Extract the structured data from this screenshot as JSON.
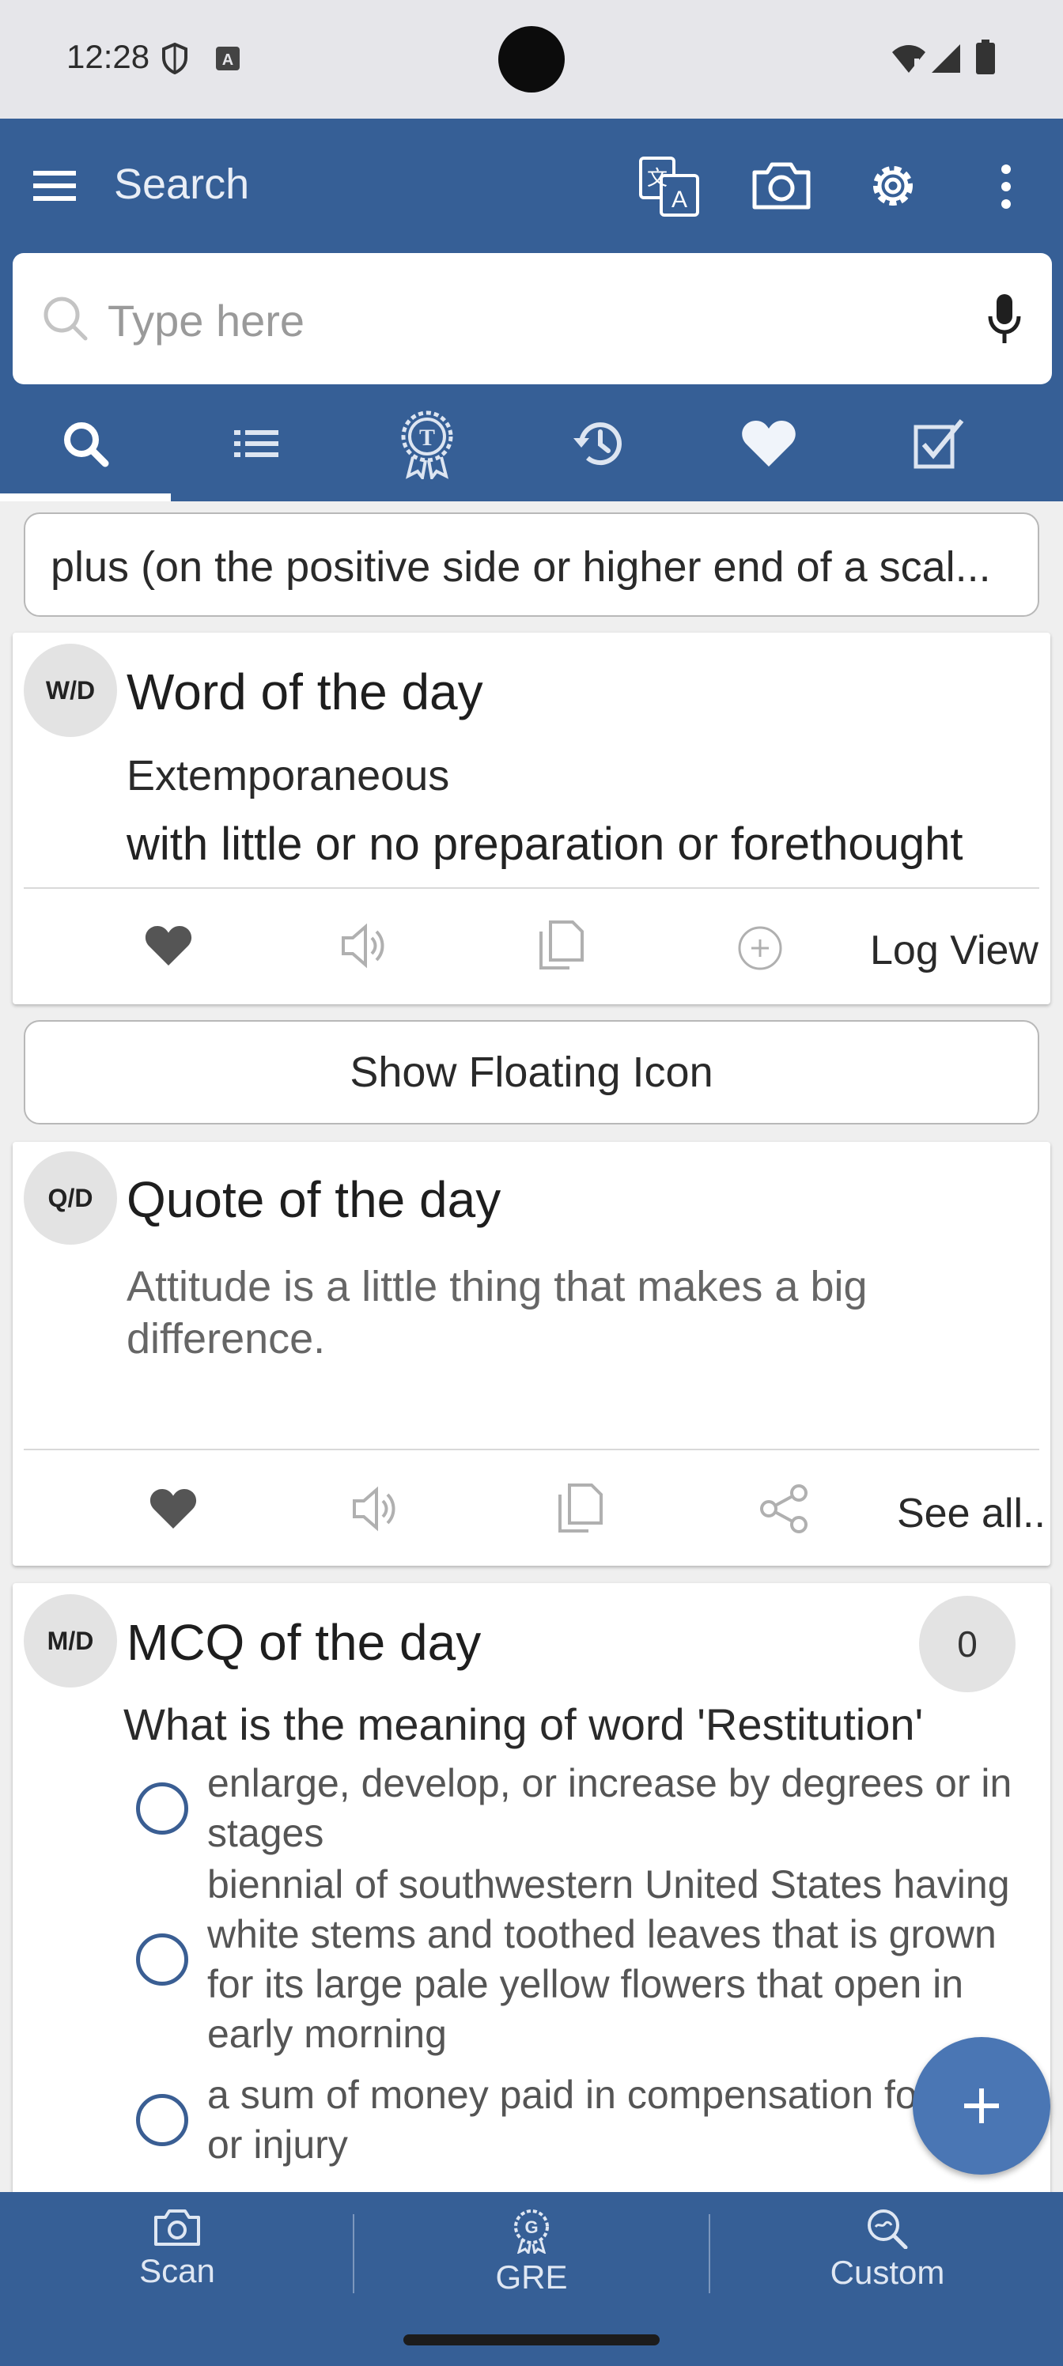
{
  "status_bar": {
    "time": "12:28"
  },
  "app_bar": {
    "title": "Search"
  },
  "search": {
    "placeholder": "Type here",
    "value": ""
  },
  "tabs": [
    "search",
    "list",
    "test",
    "history",
    "favorites",
    "quiz"
  ],
  "meaning_box": {
    "text": "plus  (on the positive side or higher end of a scal..."
  },
  "word_of_day": {
    "badge": "W/D",
    "title": "Word of the day",
    "word": "Extemporaneous",
    "definition": "with little or no preparation or forethought",
    "log_view": "Log View"
  },
  "floating_icon_button": "Show Floating Icon",
  "quote_of_day": {
    "badge": "Q/D",
    "title": "Quote of the day",
    "quote": "Attitude is a little thing that makes a big difference.",
    "see_all": "See all.."
  },
  "mcq_of_day": {
    "badge": "M/D",
    "title": "MCQ of the day",
    "count": "0",
    "question": "What is the meaning of word 'Restitution'",
    "options": [
      "enlarge, develop, or increase by degrees or in stages",
      "biennial of southwestern United States having white stems and toothed leaves that is grown for its large pale yellow flowers that open in early morning",
      "a sum of money paid in compensation for loss or injury"
    ]
  },
  "bottom_nav": {
    "scan": "Scan",
    "gre": "GRE",
    "custom": "Custom"
  },
  "colors": {
    "primary": "#365f96",
    "fab": "#4a76b4",
    "background": "#efefef"
  }
}
